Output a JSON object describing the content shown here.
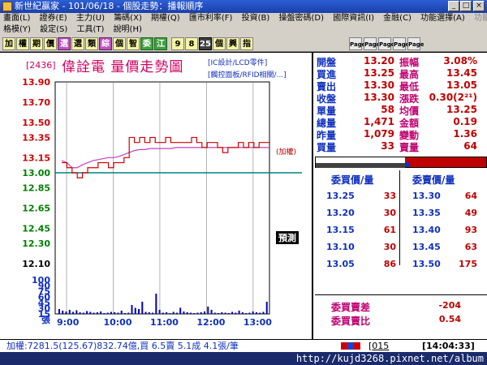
{
  "window": {
    "title": "新世紀贏家 - 101/06/18 - 個股走勢：播報順序"
  },
  "menu_row1": [
    "畫面(L)",
    "證券(E)",
    "主力(U)",
    "籌碼(X)",
    "期權(Q)",
    "匯市利率(F)",
    "投資(B)",
    "操盤密碼(D)",
    "國際資訊(I)",
    "金融(C)",
    "功能選擇(A)",
    "功能操作(F)"
  ],
  "menu_row2": [
    "格模(Y)",
    "設定(S)",
    "工具(T)",
    "說明(H)"
  ],
  "toolbar": [
    "加",
    "權",
    "期",
    "價",
    "選",
    "選",
    "類",
    "綜",
    "個",
    "智",
    "委",
    "江",
    "9",
    "8",
    "25",
    "個",
    "興",
    "指"
  ],
  "stock": {
    "code": "[2436]",
    "name": "偉詮電  量價走勢圖",
    "industry1": "[IC設計/LCD零件]",
    "industry2": "[觸控面板/RFID相關/...]",
    "ref_note": "(加權)",
    "bottom_tag": "預測"
  },
  "chart_data": {
    "type": "line",
    "price_ticks": [
      "13.90",
      "13.70",
      "13.50",
      "13.35",
      "13.15",
      "13.00",
      "12.85",
      "12.65",
      "12.45",
      "12.30",
      "12.10"
    ],
    "price_tick_colors": [
      "#d00000",
      "#d00000",
      "#d00000",
      "#d00000",
      "#d00000",
      "#008000",
      "#008000",
      "#008000",
      "#008000",
      "#008000",
      "#000000"
    ],
    "volume_ticks": [
      "100",
      "90",
      "75",
      "60",
      "45",
      "30",
      "15",
      "張"
    ],
    "x_ticks": [
      "9:00",
      "10:00",
      "11:00",
      "12:00",
      "13:00"
    ],
    "reference_price": 13.0,
    "y_range": [
      12.1,
      13.9
    ],
    "volume_range": [
      0,
      100
    ],
    "series": [
      {
        "values": [
          13.12,
          13.1,
          13.05,
          13.05,
          13.08,
          13.1,
          13.12,
          13.13,
          13.14,
          13.15,
          13.15,
          13.16,
          13.18,
          13.2,
          13.22,
          13.23,
          13.23,
          13.24,
          13.24,
          13.24,
          13.24,
          13.24,
          13.25,
          13.25,
          13.25,
          13.25,
          13.25,
          13.25,
          13.25,
          13.25,
          13.25,
          13.25,
          13.25,
          13.25,
          13.25,
          13.25,
          13.25,
          13.25,
          13.25,
          13.25,
          13.25
        ]
      },
      {
        "values": [
          13.1,
          13.05,
          13.0,
          12.95,
          13.0,
          13.05,
          13.05,
          13.1,
          13.1,
          13.05,
          13.1,
          13.1,
          13.15,
          13.35,
          13.3,
          13.35,
          13.3,
          13.35,
          13.3,
          13.3,
          13.35,
          13.3,
          13.3,
          13.3,
          13.3,
          13.35,
          13.3,
          13.25,
          13.3,
          13.3,
          13.25,
          13.2,
          13.25,
          13.25,
          13.3,
          13.25,
          13.3,
          13.25,
          13.3,
          13.3,
          13.3
        ]
      }
    ],
    "volumes": [
      12,
      8,
      6,
      10,
      5,
      9,
      4,
      3,
      7,
      5,
      3,
      4,
      6,
      2,
      3,
      5,
      4,
      3,
      8,
      2,
      3,
      22,
      15,
      12,
      30,
      5,
      4,
      3,
      50,
      10,
      3,
      4,
      2,
      5,
      3,
      15,
      6,
      4,
      3,
      2,
      3,
      4,
      6,
      18,
      10,
      3,
      2,
      4,
      3,
      2,
      5,
      3,
      8,
      4,
      2,
      3,
      6,
      4,
      3,
      5,
      30
    ]
  },
  "quote": [
    {
      "k": "開盤",
      "v": "13.20",
      "vc": "#c00000",
      "k2": "振幅",
      "v2": "3.08%",
      "v2c": "#c00000"
    },
    {
      "k": "買進",
      "v": "13.25",
      "vc": "#c00000",
      "k2": "最高",
      "v2": "13.45",
      "v2c": "#c00000"
    },
    {
      "k": "賣出",
      "v": "13.30",
      "vc": "#c00000",
      "k2": "最低",
      "v2": "13.05",
      "v2c": "#c00000"
    },
    {
      "k": "收盤",
      "v": "13.30",
      "vc": "#c00000",
      "k2": "漲跌",
      "v2": "0.30(2²¹)",
      "v2c": "#c00000"
    },
    {
      "k": "單量",
      "v": "58",
      "vc": "#c00000",
      "k2": "均價",
      "v2": "13.25",
      "v2c": "#c00000"
    },
    {
      "k": "總量",
      "v": "1,471",
      "vc": "#c00000",
      "k2": "金額",
      "v2": "0.19",
      "v2c": "#c00000"
    },
    {
      "k": "昨量",
      "v": "1,079",
      "vc": "#c00000",
      "k2": "變動",
      "v2": "1.36",
      "v2c": "#c00000"
    },
    {
      "k": "買量",
      "v": "33",
      "vc": "#c00000",
      "k2": "賣量",
      "v2": "64",
      "v2c": "#c00000"
    }
  ],
  "book": {
    "bid_header": "委買價/量",
    "ask_header": "委賣價/量",
    "rows": [
      {
        "bp": "13.25",
        "bv": "33",
        "ap": "13.30",
        "av": "64"
      },
      {
        "bp": "13.20",
        "bv": "30",
        "ap": "13.35",
        "av": "49"
      },
      {
        "bp": "13.15",
        "bv": "61",
        "ap": "13.40",
        "av": "93"
      },
      {
        "bp": "13.10",
        "bv": "30",
        "ap": "13.45",
        "av": "63"
      },
      {
        "bp": "13.05",
        "bv": "86",
        "ap": "13.50",
        "av": "175"
      }
    ],
    "diff_label": "委買賣差",
    "diff_value": "-204",
    "ratio_label": "委買賣比",
    "ratio_value": "0.54"
  },
  "status": {
    "index_text": "加權:7281.5(125.67)832.74億,買 6.5賣 5.1成 4.1張/筆",
    "code_box": "015",
    "time": "14:04:33"
  },
  "watermark": "http://kujd3268.pixnet.net/album",
  "colors": {
    "price_up": "#d00000",
    "price_down": "#008000",
    "avg_line": "#c040c0",
    "ref_line": "#008080",
    "volume_bar": "#0000c0"
  }
}
